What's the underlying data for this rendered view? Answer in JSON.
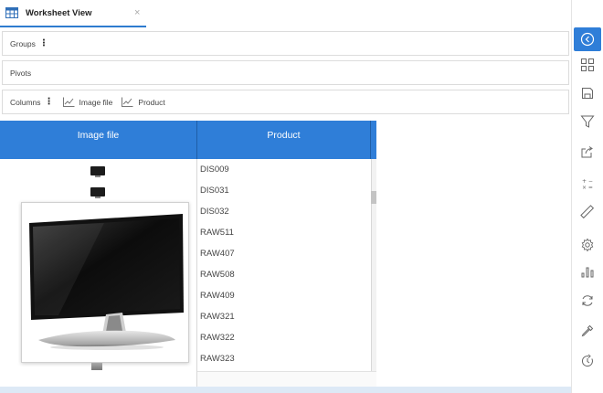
{
  "tab": {
    "title": "Worksheet View",
    "close": "×"
  },
  "panels": {
    "groups_label": "Groups",
    "pivots_label": "Pivots",
    "columns_label": "Columns",
    "kebab": "⋮",
    "column_chips": [
      "Image file",
      "Product"
    ]
  },
  "grid": {
    "headers": [
      "Image file",
      "Product"
    ],
    "rows": [
      "DIS009",
      "DIS031",
      "DIS032",
      "RAW511",
      "RAW407",
      "RAW508",
      "RAW409",
      "RAW321",
      "RAW322",
      "RAW323"
    ]
  },
  "toolbar": {
    "icons": [
      "back-icon",
      "grid-layout-icon",
      "save-icon",
      "filter-icon",
      "export-icon",
      "calculator-icon",
      "ruler-icon",
      "gear-icon",
      "bar-chart-icon",
      "refresh-icon",
      "eyedropper-icon",
      "history-icon"
    ],
    "calc_symbols": "+ −\n× ="
  },
  "colors": {
    "accent": "#2f7ed8",
    "header_text": "#ffffff"
  }
}
